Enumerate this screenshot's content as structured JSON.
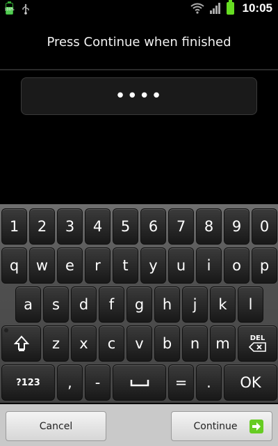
{
  "status_bar": {
    "battery_small_text": "100%",
    "time": "10:05",
    "icons": [
      "battery-icon",
      "usb-icon",
      "wifi-icon",
      "signal-icon",
      "battery-icon"
    ]
  },
  "screen": {
    "prompt": "Press Continue when finished",
    "pin_value": "••••"
  },
  "keyboard": {
    "rows": [
      [
        "1",
        "2",
        "3",
        "4",
        "5",
        "6",
        "7",
        "8",
        "9",
        "0"
      ],
      [
        "q",
        "w",
        "e",
        "r",
        "t",
        "y",
        "u",
        "i",
        "o",
        "p"
      ],
      [
        "a",
        "s",
        "d",
        "f",
        "g",
        "h",
        "j",
        "k",
        "l"
      ],
      [
        "shift",
        "z",
        "x",
        "c",
        "v",
        "b",
        "n",
        "m",
        "DEL"
      ],
      [
        "?123",
        ",",
        "-",
        "space",
        "=",
        ".",
        "OK"
      ]
    ],
    "del_label": "DEL",
    "symbols_label": "?123",
    "ok_label": "OK"
  },
  "buttons": {
    "cancel": "Cancel",
    "continue": "Continue"
  },
  "colors": {
    "battery_green": "#66dd22",
    "continue_arrow": "#66cc22"
  }
}
